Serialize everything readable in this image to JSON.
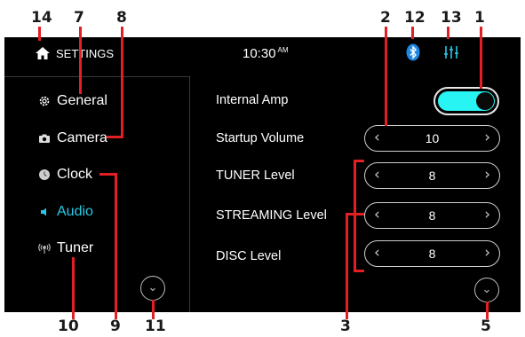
{
  "header": {
    "title": "SETTINGS",
    "time": "10:30",
    "time_suffix": "AM",
    "home_icon": "home-icon",
    "bluetooth_icon": "bluetooth-icon",
    "equalizer_icon": "equalizer-icon"
  },
  "sidebar": {
    "items": [
      {
        "label": "General",
        "icon": "gear-icon",
        "active": false
      },
      {
        "label": "Camera",
        "icon": "camera-icon",
        "active": false
      },
      {
        "label": "Clock",
        "icon": "clock-icon",
        "active": false
      },
      {
        "label": "Audio",
        "icon": "speaker-icon",
        "active": true
      },
      {
        "label": "Tuner",
        "icon": "antenna-icon",
        "active": false
      }
    ]
  },
  "main": {
    "internal_amp_label": "Internal Amp",
    "internal_amp_on": true,
    "startup_volume_label": "Startup Volume",
    "startup_volume_value": "10",
    "tuner_level_label": "TUNER Level",
    "tuner_level_value": "8",
    "streaming_level_label": "STREAMING Level",
    "streaming_level_value": "8",
    "disc_level_label": "DISC Level",
    "disc_level_value": "8"
  },
  "callouts": {
    "c1": "1",
    "c2": "2",
    "c3": "3",
    "c5": "5",
    "c7": "7",
    "c8": "8",
    "c9": "9",
    "c10": "10",
    "c11": "11",
    "c12": "12",
    "c13": "13",
    "c14": "14"
  },
  "colors": {
    "accent": "#25c9e6",
    "toggle_on": "#29f4f4",
    "callout_line": "#e31e24",
    "bluetooth": "#1e88e5"
  }
}
